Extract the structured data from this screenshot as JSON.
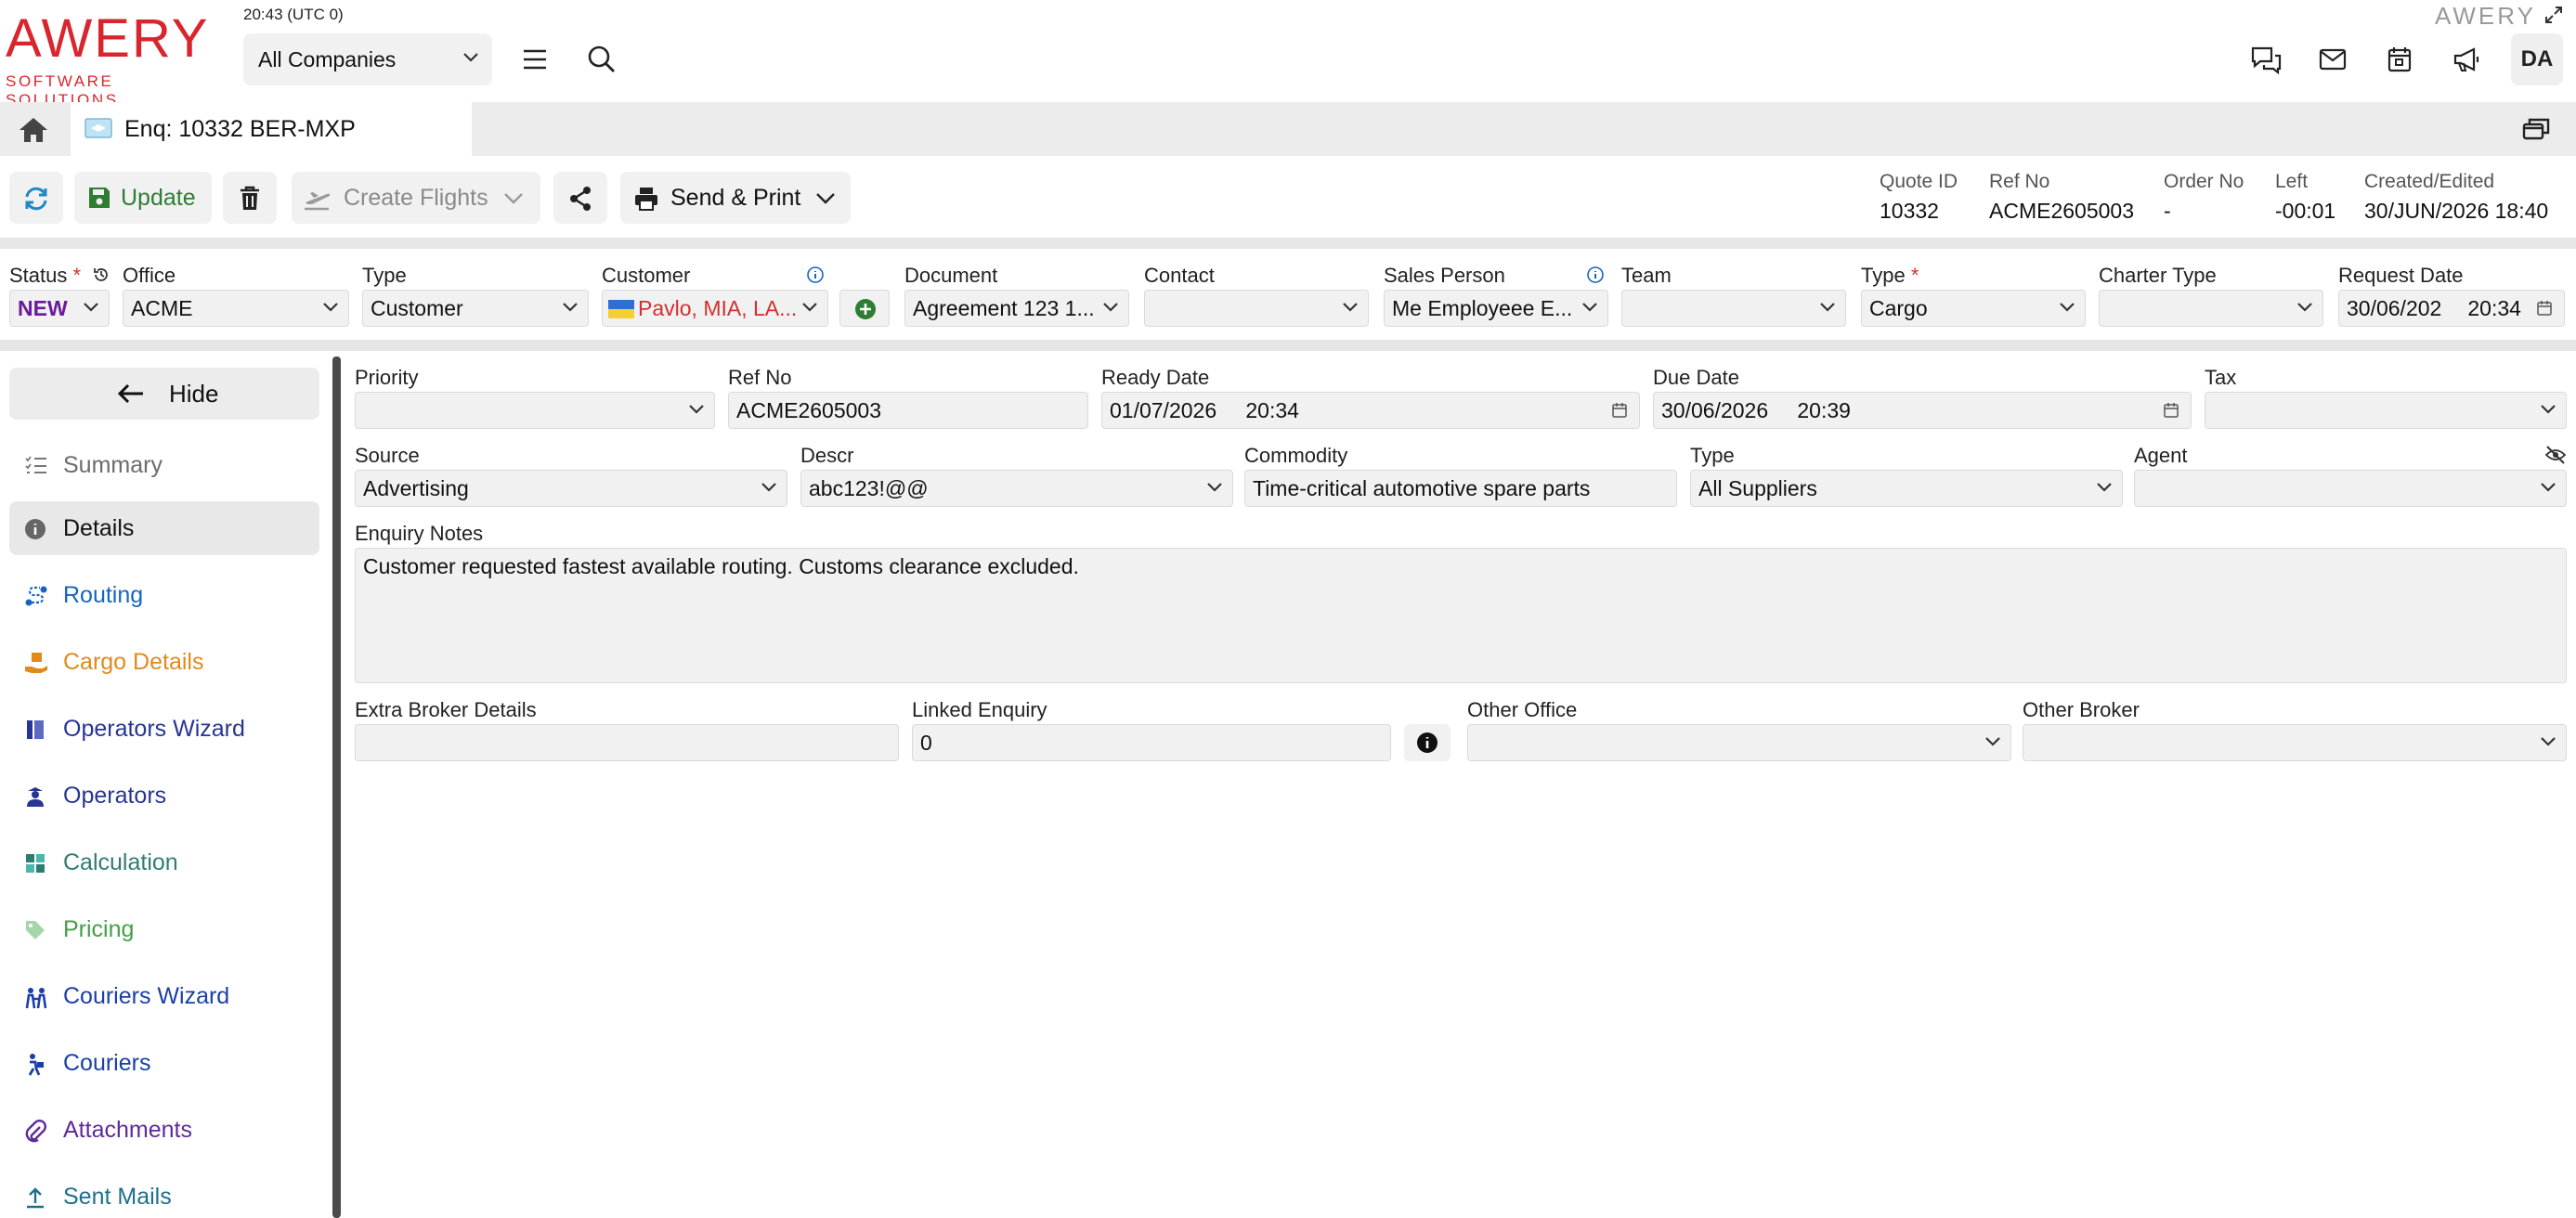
{
  "app": {
    "logo_text": "AWERY",
    "logo_subtitle": "SOFTWARE SOLUTIONS",
    "clock": "20:43 (UTC 0)",
    "company_selector": "All Companies",
    "brand_small": "AWERY",
    "user_initials": "DA",
    "accent_color": "#d9262e"
  },
  "tabs": {
    "home_icon": "home-icon",
    "active_tab": "Enq: 10332 BER-MXP"
  },
  "toolbar": {
    "update_label": "Update",
    "create_flights_label": "Create Flights",
    "send_print_label": "Send & Print",
    "meta": [
      {
        "key": "Quote ID",
        "value": "10332"
      },
      {
        "key": "Ref No",
        "value": "ACME2605003"
      },
      {
        "key": "Order No",
        "value": "-"
      },
      {
        "key": "Left",
        "value": "-00:01"
      },
      {
        "key": "Created/Edited",
        "value": "30/JUN/2026 18:40"
      }
    ]
  },
  "header_form": {
    "status": {
      "label": "Status",
      "value": "NEW",
      "value_color": "#6a1b9a"
    },
    "office": {
      "label": "Office",
      "value": "ACME"
    },
    "type": {
      "label": "Type",
      "value": "Customer"
    },
    "customer": {
      "label": "Customer",
      "value": "Pavlo, MIA, LA...",
      "value_color": "#d32f2f"
    },
    "document": {
      "label": "Document",
      "value": "Agreement 123 1..."
    },
    "contact": {
      "label": "Contact",
      "value": ""
    },
    "sales_person": {
      "label": "Sales Person",
      "value": "Me Employeee E..."
    },
    "team": {
      "label": "Team",
      "value": ""
    },
    "cargo_type": {
      "label": "Type",
      "value": "Cargo"
    },
    "charter_type": {
      "label": "Charter Type",
      "value": ""
    },
    "request_date": {
      "label": "Request Date",
      "date": "30/06/202",
      "time": "20:34"
    }
  },
  "sidebar": {
    "hide_label": "Hide",
    "items": [
      {
        "label": "Summary",
        "color": "#6b6b6b"
      },
      {
        "label": "Details",
        "color": "#111111"
      },
      {
        "label": "Routing",
        "color": "#1565c0"
      },
      {
        "label": "Cargo Details",
        "color": "#e08a1e"
      },
      {
        "label": "Operators Wizard",
        "color": "#283593"
      },
      {
        "label": "Operators",
        "color": "#283593"
      },
      {
        "label": "Calculation",
        "color": "#2e7d73"
      },
      {
        "label": "Pricing",
        "color": "#43a047"
      },
      {
        "label": "Couriers Wizard",
        "color": "#1a3fa8"
      },
      {
        "label": "Couriers",
        "color": "#1a3fa8"
      },
      {
        "label": "Attachments",
        "color": "#5e2b97"
      },
      {
        "label": "Sent Mails",
        "color": "#1e6f8c"
      }
    ]
  },
  "details": {
    "priority": {
      "label": "Priority",
      "value": ""
    },
    "ref_no": {
      "label": "Ref No",
      "value": "ACME2605003"
    },
    "ready_date": {
      "label": "Ready Date",
      "date": "01/07/2026",
      "time": "20:34"
    },
    "due_date": {
      "label": "Due Date",
      "date": "30/06/2026",
      "time": "20:39"
    },
    "tax": {
      "label": "Tax",
      "value": ""
    },
    "source": {
      "label": "Source",
      "value": "Advertising"
    },
    "descr": {
      "label": "Descr",
      "value": "abc123!@@"
    },
    "commodity": {
      "label": "Commodity",
      "value": "Time-critical automotive spare parts"
    },
    "supplier_type": {
      "label": "Type",
      "value": "All Suppliers"
    },
    "agent": {
      "label": "Agent",
      "value": ""
    },
    "enquiry_notes": {
      "label": "Enquiry Notes",
      "value": "Customer requested fastest available routing. Customs clearance excluded."
    },
    "extra_broker": {
      "label": "Extra Broker Details",
      "value": ""
    },
    "linked_enquiry": {
      "label": "Linked Enquiry",
      "value": "0"
    },
    "other_office": {
      "label": "Other Office",
      "value": ""
    },
    "other_broker": {
      "label": "Other Broker",
      "value": ""
    }
  }
}
